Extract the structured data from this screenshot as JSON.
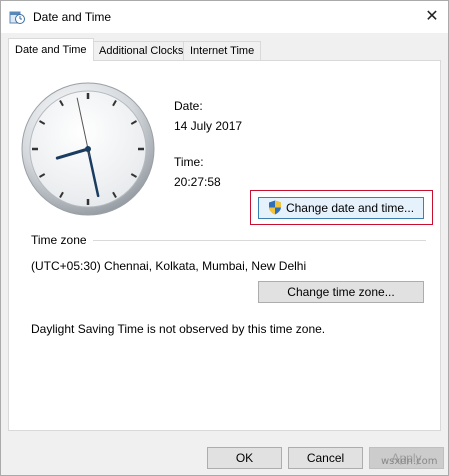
{
  "window": {
    "title": "Date and Time",
    "close_glyph": "✕",
    "app_icon": "datetime-icon"
  },
  "tabs": [
    {
      "label": "Date and Time",
      "active": true
    },
    {
      "label": "Additional Clocks",
      "active": false
    },
    {
      "label": "Internet Time",
      "active": false
    }
  ],
  "clock": {
    "hour": 20,
    "minute": 27,
    "second": 58
  },
  "date": {
    "label": "Date:",
    "value": "14 July 2017"
  },
  "time": {
    "label": "Time:",
    "value": "20:27:58"
  },
  "change_button": {
    "label": "Change date and time...",
    "icon": "uac-shield-icon"
  },
  "timezone": {
    "heading": "Time zone",
    "value": "(UTC+05:30) Chennai, Kolkata, Mumbai, New Delhi",
    "button": "Change time zone..."
  },
  "dst_note": "Daylight Saving Time is not observed by this time zone.",
  "footer": {
    "ok": "OK",
    "cancel": "Cancel",
    "apply": "Apply"
  },
  "watermark": "wsxdn.com",
  "colors": {
    "highlight": "#c8102e",
    "accent_button": "#3c7fb1",
    "clock_hands": "#1a3c60"
  }
}
